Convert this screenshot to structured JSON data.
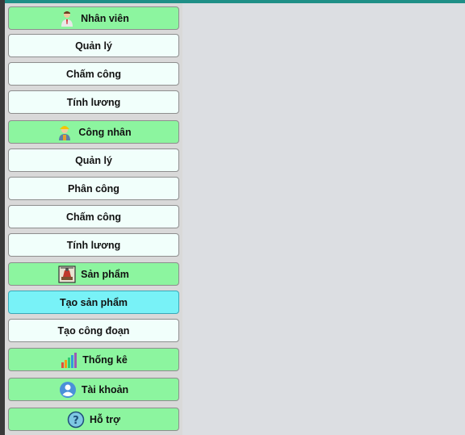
{
  "sidebar": {
    "sections": [
      {
        "label": "Nhân viên",
        "icon": "employee-icon",
        "items": [
          "Quản lý",
          "Chấm công",
          "Tính lương"
        ]
      },
      {
        "label": "Công nhân",
        "icon": "worker-icon",
        "items": [
          "Quản lý",
          "Phân công",
          "Chấm công",
          "Tính lương"
        ]
      },
      {
        "label": "Sản phẩm",
        "icon": "product-icon",
        "items": [
          "Tạo sản phẩm",
          "Tạo công đoạn"
        ],
        "active_item": "Tạo sản phẩm"
      },
      {
        "label": "Thống kê",
        "icon": "statistics-icon",
        "items": []
      },
      {
        "label": "Tài khoản",
        "icon": "account-icon",
        "items": []
      },
      {
        "label": "Hỗ trợ",
        "icon": "help-icon",
        "items": []
      }
    ]
  },
  "colors": {
    "header_bg": "#8cf59f",
    "item_bg": "#f1fffb",
    "active_bg": "#78f2f7",
    "top_bar": "#1f8f87"
  }
}
